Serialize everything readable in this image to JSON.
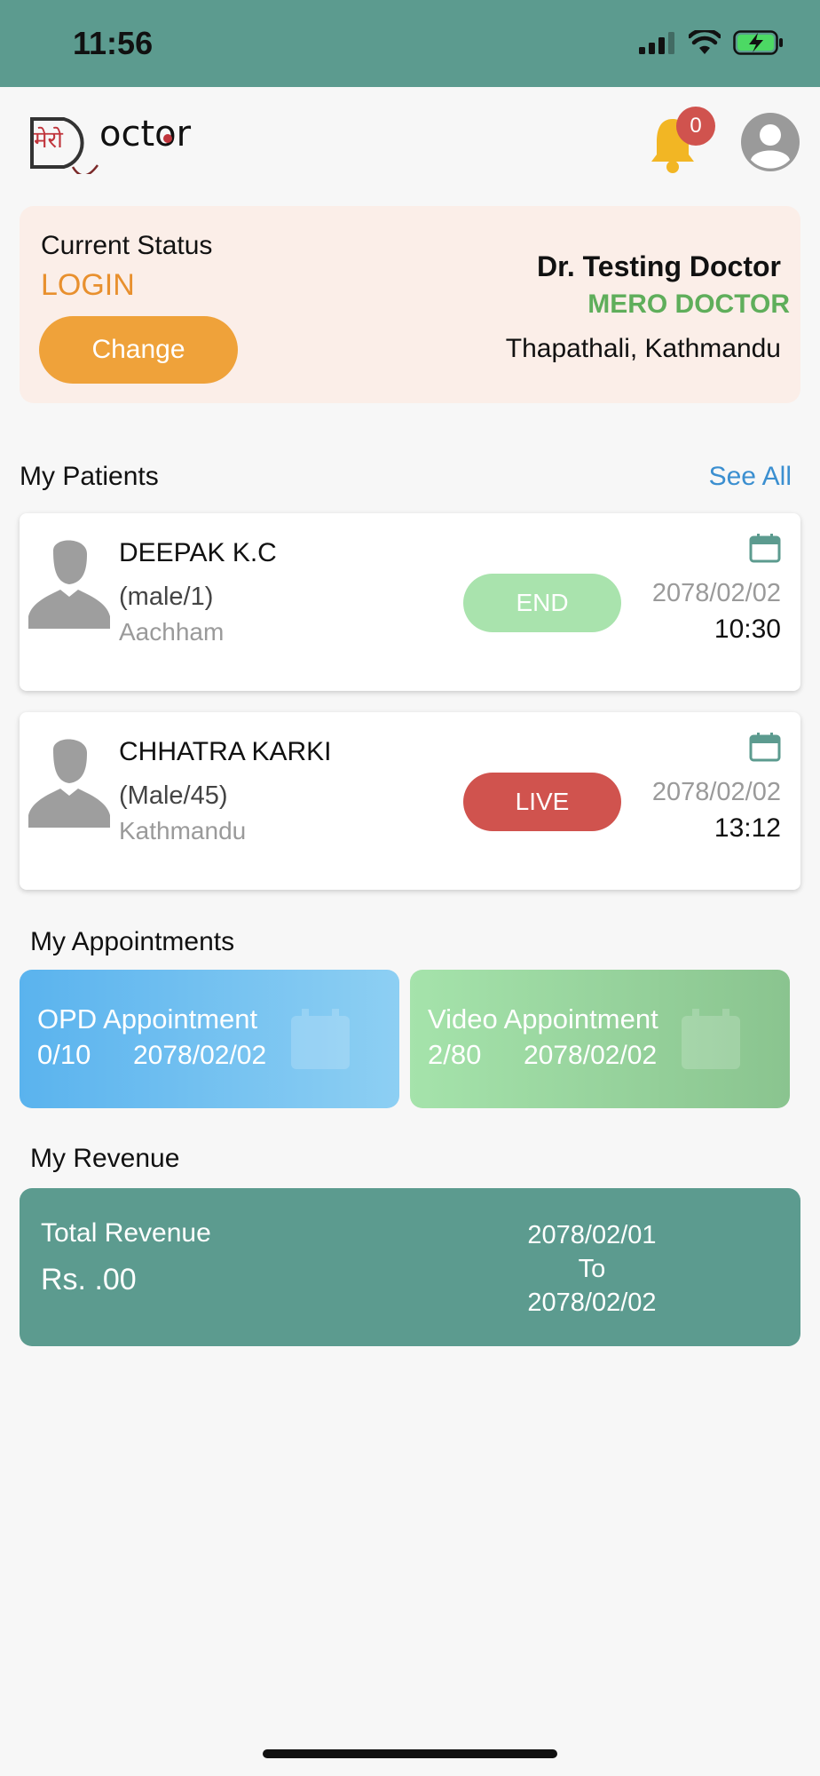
{
  "status_bar": {
    "time": "11:56"
  },
  "header": {
    "logo_text_devanagari": "मेरो",
    "logo_text_latin": "Doctor",
    "notification_count": "0"
  },
  "status_card": {
    "label": "Current Status",
    "value": "LOGIN",
    "change_label": "Change",
    "doctor_name": "Dr. Testing Doctor",
    "organization": "MERO DOCTOR",
    "location": "Thapathali, Kathmandu"
  },
  "patients": {
    "title": "My Patients",
    "see_all": "See All",
    "items": [
      {
        "name": "DEEPAK K.C",
        "info": "(male/1)",
        "address": "Aachham",
        "status": "END",
        "date": "2078/02/02",
        "time": "10:30"
      },
      {
        "name": "CHHATRA KARKI",
        "info": "(Male/45)",
        "address": "Kathmandu",
        "status": "LIVE",
        "date": "2078/02/02",
        "time": "13:12"
      }
    ]
  },
  "appointments": {
    "title": "My Appointments",
    "opd": {
      "title": "OPD Appointment",
      "count": "0/10",
      "date": "2078/02/02"
    },
    "video": {
      "title": "Video Appointment",
      "count": "2/80",
      "date": "2078/02/02"
    }
  },
  "revenue": {
    "title": "My Revenue",
    "label": "Total Revenue",
    "value": "Rs. .00",
    "from": "2078/02/01",
    "to_label": "To",
    "to": "2078/02/02"
  },
  "colors": {
    "primary": "#5c9b8f",
    "status_orange": "#e8902e",
    "button_orange": "#efa23a",
    "org_green": "#5fae5b",
    "end_pill": "#a9e3ad",
    "live_pill": "#d0534e",
    "link_blue": "#3b8fd0"
  }
}
